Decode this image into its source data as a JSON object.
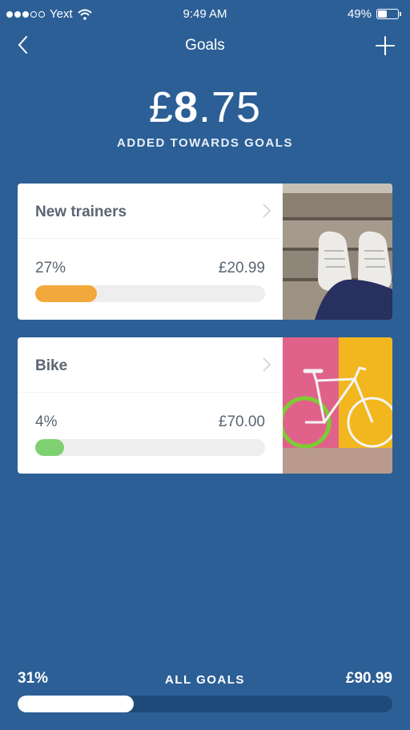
{
  "status_bar": {
    "carrier": "Yext",
    "time": "9:49 AM",
    "battery_text": "49%",
    "battery_level": 0.49
  },
  "nav": {
    "title": "Goals"
  },
  "summary": {
    "currency": "£",
    "amount_int": "8",
    "amount_dec": ".75",
    "label": "ADDED TOWARDS GOALS"
  },
  "goals": [
    {
      "title": "New trainers",
      "percent_text": "27%",
      "amount": "£20.99",
      "progress": 0.27,
      "color": "#f2a93b"
    },
    {
      "title": "Bike",
      "percent_text": "4%",
      "amount": "£70.00",
      "progress": 0.04,
      "color": "#7ed071"
    }
  ],
  "all_goals": {
    "percent_text": "31%",
    "label": "ALL GOALS",
    "amount": "£90.99",
    "progress": 0.31
  },
  "colors": {
    "background": "#2c5f96",
    "card_text": "#5b6672",
    "track": "#eeeeee"
  }
}
